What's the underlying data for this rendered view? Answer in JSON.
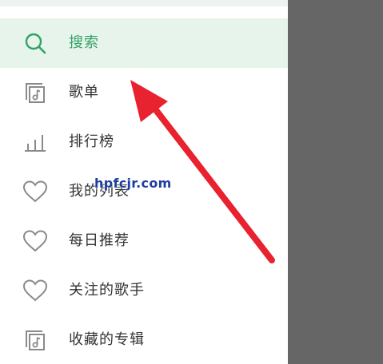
{
  "drawer": {
    "items": [
      {
        "label": "搜索",
        "icon": "search-icon",
        "active": true
      },
      {
        "label": "歌单",
        "icon": "music-note-box-icon",
        "active": false
      },
      {
        "label": "排行榜",
        "icon": "bar-chart-icon",
        "active": false
      },
      {
        "label": "我的列表",
        "icon": "heart-icon",
        "active": false
      },
      {
        "label": "每日推荐",
        "icon": "heart-icon",
        "active": false
      },
      {
        "label": "关注的歌手",
        "icon": "heart-icon",
        "active": false
      },
      {
        "label": "收藏的专辑",
        "icon": "music-note-box-icon",
        "active": false
      }
    ]
  },
  "watermark": {
    "text": "hpfcjr.com"
  },
  "colors": {
    "accent": "#33a165",
    "active_bg": "#e6f4ec",
    "icon": "#8a8a8a",
    "overlay": "#666666",
    "arrow": "#e8222f"
  }
}
